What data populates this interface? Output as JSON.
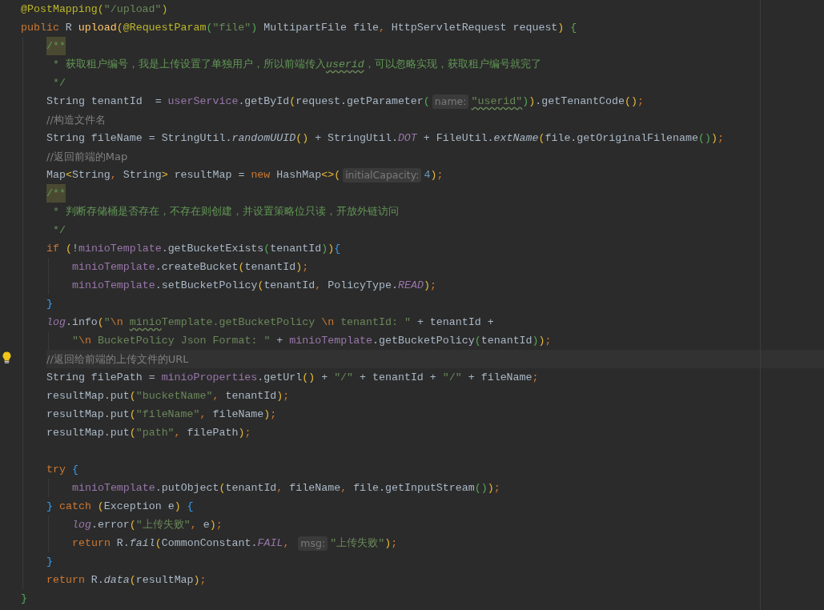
{
  "editor": {
    "lines": [
      {
        "tokens": [
          {
            "kind": "ann",
            "text": "@PostMapping("
          },
          {
            "kind": "str",
            "text": "\"/upload\""
          },
          {
            "kind": "ann",
            "text": ")"
          }
        ]
      },
      {
        "tokens": [
          {
            "kind": "kw",
            "text": "public "
          },
          {
            "kind": "p",
            "text": "R "
          },
          {
            "kind": "mth",
            "text": "upload"
          },
          {
            "kind": "b1",
            "text": "("
          },
          {
            "kind": "ann",
            "text": "@RequestParam"
          },
          {
            "kind": "b2",
            "text": "("
          },
          {
            "kind": "str",
            "text": "\"file\""
          },
          {
            "kind": "b2",
            "text": ")"
          },
          {
            "kind": "p",
            "text": " MultipartFile file"
          },
          {
            "kind": "punct",
            "text": ","
          },
          {
            "kind": "p",
            "text": " HttpServletRequest request"
          },
          {
            "kind": "b1",
            "text": ") "
          },
          {
            "kind": "b2",
            "text": "{"
          }
        ],
        "children": [
          {
            "tokens": [
              {
                "kind": "docstart",
                "text": "/**"
              }
            ]
          },
          {
            "tokens": [
              {
                "kind": "doc",
                "text": " * 获取租户编号，我是上传设置了单独用户，所以前端传入"
              },
              {
                "kind": "docref",
                "text": "userid"
              },
              {
                "kind": "doc",
                "text": "，可以忽略实现，获取租户编号就完了"
              }
            ]
          },
          {
            "tokens": [
              {
                "kind": "doc",
                "text": " */"
              }
            ]
          },
          {
            "tokens": [
              {
                "kind": "p",
                "text": "String tenantId  = "
              },
              {
                "kind": "fld",
                "text": "userService"
              },
              {
                "kind": "p",
                "text": ".getById"
              },
              {
                "kind": "b1",
                "text": "("
              },
              {
                "kind": "p",
                "text": "request.getParameter"
              },
              {
                "kind": "b2",
                "text": "("
              },
              {
                "kind": "hint",
                "text": "name:"
              },
              {
                "kind": "typo",
                "text": "\"userid\""
              },
              {
                "kind": "b2",
                "text": ")"
              },
              {
                "kind": "b1",
                "text": ")"
              },
              {
                "kind": "p",
                "text": ".getTenantCode"
              },
              {
                "kind": "b1",
                "text": "()"
              },
              {
                "kind": "punct",
                "text": ";"
              }
            ]
          },
          {
            "tokens": [
              {
                "kind": "cmt",
                "text": "//构造文件名"
              }
            ]
          },
          {
            "tokens": [
              {
                "kind": "p",
                "text": "String fileName = StringUtil."
              },
              {
                "kind": "sm",
                "text": "randomUUID"
              },
              {
                "kind": "b1",
                "text": "()"
              },
              {
                "kind": "p",
                "text": " + StringUtil."
              },
              {
                "kind": "sfld",
                "text": "DOT"
              },
              {
                "kind": "p",
                "text": " + FileUtil."
              },
              {
                "kind": "sm",
                "text": "extName"
              },
              {
                "kind": "b1",
                "text": "("
              },
              {
                "kind": "p",
                "text": "file.getOriginalFilename"
              },
              {
                "kind": "b2",
                "text": "()"
              },
              {
                "kind": "b1",
                "text": ")"
              },
              {
                "kind": "punct",
                "text": ";"
              }
            ]
          },
          {
            "tokens": [
              {
                "kind": "cmt",
                "text": "//返回前端的Map"
              }
            ]
          },
          {
            "tokens": [
              {
                "kind": "p",
                "text": "Map"
              },
              {
                "kind": "b1",
                "text": "<"
              },
              {
                "kind": "p",
                "text": "String"
              },
              {
                "kind": "punct",
                "text": ","
              },
              {
                "kind": "p",
                "text": " String"
              },
              {
                "kind": "b1",
                "text": ">"
              },
              {
                "kind": "p",
                "text": " resultMap = "
              },
              {
                "kind": "kw",
                "text": "new"
              },
              {
                "kind": "p",
                "text": " HashMap"
              },
              {
                "kind": "b1",
                "text": "<>("
              },
              {
                "kind": "hint",
                "text": "initialCapacity:"
              },
              {
                "kind": "num",
                "text": "4"
              },
              {
                "kind": "b1",
                "text": ")"
              },
              {
                "kind": "punct",
                "text": ";"
              }
            ]
          },
          {
            "tokens": [
              {
                "kind": "docstart",
                "text": "/**"
              }
            ]
          },
          {
            "tokens": [
              {
                "kind": "doc",
                "text": " * 判断存储桶是否存在，不存在则创建，并设置策略位只读，开放外链访问"
              }
            ]
          },
          {
            "tokens": [
              {
                "kind": "doc",
                "text": " */"
              }
            ]
          },
          {
            "tokens": [
              {
                "kind": "kw",
                "text": "if "
              },
              {
                "kind": "b1",
                "text": "("
              },
              {
                "kind": "p",
                "text": "!"
              },
              {
                "kind": "fld",
                "text": "minioTemplate"
              },
              {
                "kind": "p",
                "text": ".getBucketExists"
              },
              {
                "kind": "b2",
                "text": "("
              },
              {
                "kind": "p",
                "text": "tenantId"
              },
              {
                "kind": "b2",
                "text": ")"
              },
              {
                "kind": "b1",
                "text": ")"
              },
              {
                "kind": "b3",
                "text": "{"
              }
            ],
            "children": [
              {
                "tokens": [
                  {
                    "kind": "fld",
                    "text": "minioTemplate"
                  },
                  {
                    "kind": "p",
                    "text": ".createBucket"
                  },
                  {
                    "kind": "b1",
                    "text": "("
                  },
                  {
                    "kind": "p",
                    "text": "tenantId"
                  },
                  {
                    "kind": "b1",
                    "text": ")"
                  },
                  {
                    "kind": "punct",
                    "text": ";"
                  }
                ]
              },
              {
                "tokens": [
                  {
                    "kind": "fld",
                    "text": "minioTemplate"
                  },
                  {
                    "kind": "p",
                    "text": ".setBucketPolicy"
                  },
                  {
                    "kind": "b1",
                    "text": "("
                  },
                  {
                    "kind": "p",
                    "text": "tenantId"
                  },
                  {
                    "kind": "punct",
                    "text": ","
                  },
                  {
                    "kind": "p",
                    "text": " PolicyType."
                  },
                  {
                    "kind": "sfld",
                    "text": "READ"
                  },
                  {
                    "kind": "b1",
                    "text": ")"
                  },
                  {
                    "kind": "punct",
                    "text": ";"
                  }
                ]
              }
            ]
          },
          {
            "tokens": [
              {
                "kind": "b3",
                "text": "}"
              }
            ]
          },
          {
            "tokens": [
              {
                "kind": "sfld",
                "text": "log"
              },
              {
                "kind": "p",
                "text": ".info"
              },
              {
                "kind": "b1",
                "text": "("
              },
              {
                "kind": "str",
                "text": "\""
              },
              {
                "kind": "kw",
                "text": "\\n "
              },
              {
                "kind": "typo",
                "text": "minio"
              },
              {
                "kind": "str",
                "text": "Template.getBucketPolicy "
              },
              {
                "kind": "kw",
                "text": "\\n"
              },
              {
                "kind": "str",
                "text": " tenantId: \""
              },
              {
                "kind": "p",
                "text": " + tenantId +"
              }
            ],
            "children": [
              {
                "tokens": [
                  {
                    "kind": "str",
                    "text": "\""
                  },
                  {
                    "kind": "kw",
                    "text": "\\n"
                  },
                  {
                    "kind": "str",
                    "text": " BucketPolicy Json Format: \""
                  },
                  {
                    "kind": "p",
                    "text": " + "
                  },
                  {
                    "kind": "fld",
                    "text": "minioTemplate"
                  },
                  {
                    "kind": "p",
                    "text": ".getBucketPolicy"
                  },
                  {
                    "kind": "b2",
                    "text": "("
                  },
                  {
                    "kind": "p",
                    "text": "tenantId"
                  },
                  {
                    "kind": "b2",
                    "text": ")"
                  },
                  {
                    "kind": "b1",
                    "text": ")"
                  },
                  {
                    "kind": "punct",
                    "text": ";"
                  }
                ]
              }
            ]
          },
          {
            "current": true,
            "tokens": [
              {
                "kind": "cmt",
                "text": "//返回给前端的上传文件的URL"
              }
            ]
          },
          {
            "tokens": [
              {
                "kind": "p",
                "text": "String filePath = "
              },
              {
                "kind": "fld",
                "text": "minioProperties"
              },
              {
                "kind": "p",
                "text": ".getUrl"
              },
              {
                "kind": "b1",
                "text": "()"
              },
              {
                "kind": "p",
                "text": " + "
              },
              {
                "kind": "str",
                "text": "\"/\""
              },
              {
                "kind": "p",
                "text": " + tenantId + "
              },
              {
                "kind": "str",
                "text": "\"/\""
              },
              {
                "kind": "p",
                "text": " + fileName"
              },
              {
                "kind": "punct",
                "text": ";"
              }
            ]
          },
          {
            "tokens": [
              {
                "kind": "p",
                "text": "resultMap.put"
              },
              {
                "kind": "b1",
                "text": "("
              },
              {
                "kind": "str",
                "text": "\"bucketName\""
              },
              {
                "kind": "punct",
                "text": ","
              },
              {
                "kind": "p",
                "text": " tenantId"
              },
              {
                "kind": "b1",
                "text": ")"
              },
              {
                "kind": "punct",
                "text": ";"
              }
            ]
          },
          {
            "tokens": [
              {
                "kind": "p",
                "text": "resultMap.put"
              },
              {
                "kind": "b1",
                "text": "("
              },
              {
                "kind": "str",
                "text": "\"fileName\""
              },
              {
                "kind": "punct",
                "text": ","
              },
              {
                "kind": "p",
                "text": " fileName"
              },
              {
                "kind": "b1",
                "text": ")"
              },
              {
                "kind": "punct",
                "text": ";"
              }
            ]
          },
          {
            "gap_after": true,
            "tokens": [
              {
                "kind": "p",
                "text": "resultMap.put"
              },
              {
                "kind": "b1",
                "text": "("
              },
              {
                "kind": "str",
                "text": "\"path\""
              },
              {
                "kind": "punct",
                "text": ","
              },
              {
                "kind": "p",
                "text": " filePath"
              },
              {
                "kind": "b1",
                "text": ")"
              },
              {
                "kind": "punct",
                "text": ";"
              }
            ]
          },
          {
            "tokens": [
              {
                "kind": "kw",
                "text": "try "
              },
              {
                "kind": "b3",
                "text": "{"
              }
            ],
            "children": [
              {
                "tokens": [
                  {
                    "kind": "fld",
                    "text": "minioTemplate"
                  },
                  {
                    "kind": "p",
                    "text": ".putObject"
                  },
                  {
                    "kind": "b1",
                    "text": "("
                  },
                  {
                    "kind": "p",
                    "text": "tenantId"
                  },
                  {
                    "kind": "punct",
                    "text": ","
                  },
                  {
                    "kind": "p",
                    "text": " fileName"
                  },
                  {
                    "kind": "punct",
                    "text": ","
                  },
                  {
                    "kind": "p",
                    "text": " file.getInputStream"
                  },
                  {
                    "kind": "b2",
                    "text": "()"
                  },
                  {
                    "kind": "b1",
                    "text": ")"
                  },
                  {
                    "kind": "punct",
                    "text": ";"
                  }
                ]
              }
            ]
          },
          {
            "tokens": [
              {
                "kind": "b3",
                "text": "} "
              },
              {
                "kind": "kw",
                "text": "catch "
              },
              {
                "kind": "b1",
                "text": "("
              },
              {
                "kind": "p",
                "text": "Exception e"
              },
              {
                "kind": "b1",
                "text": ") "
              },
              {
                "kind": "b3",
                "text": "{"
              }
            ],
            "children": [
              {
                "tokens": [
                  {
                    "kind": "sfld",
                    "text": "log"
                  },
                  {
                    "kind": "p",
                    "text": ".error"
                  },
                  {
                    "kind": "b1",
                    "text": "("
                  },
                  {
                    "kind": "str",
                    "text": "\"上传失败\""
                  },
                  {
                    "kind": "punct",
                    "text": ","
                  },
                  {
                    "kind": "p",
                    "text": " e"
                  },
                  {
                    "kind": "b1",
                    "text": ")"
                  },
                  {
                    "kind": "punct",
                    "text": ";"
                  }
                ]
              },
              {
                "tokens": [
                  {
                    "kind": "kw",
                    "text": "return"
                  },
                  {
                    "kind": "p",
                    "text": " R."
                  },
                  {
                    "kind": "sm",
                    "text": "fail"
                  },
                  {
                    "kind": "b1",
                    "text": "("
                  },
                  {
                    "kind": "p",
                    "text": "CommonConstant."
                  },
                  {
                    "kind": "sfld",
                    "text": "FAIL"
                  },
                  {
                    "kind": "punct",
                    "text": ", "
                  },
                  {
                    "kind": "hint",
                    "text": "msg:"
                  },
                  {
                    "kind": "str",
                    "text": "\"上传失败\""
                  },
                  {
                    "kind": "b1",
                    "text": ")"
                  },
                  {
                    "kind": "punct",
                    "text": ";"
                  }
                ]
              }
            ]
          },
          {
            "tokens": [
              {
                "kind": "b3",
                "text": "}"
              }
            ]
          },
          {
            "tokens": [
              {
                "kind": "kw",
                "text": "return"
              },
              {
                "kind": "p",
                "text": " R."
              },
              {
                "kind": "sm",
                "text": "data"
              },
              {
                "kind": "b1",
                "text": "("
              },
              {
                "kind": "p",
                "text": "resultMap"
              },
              {
                "kind": "b1",
                "text": ")"
              },
              {
                "kind": "punct",
                "text": ";"
              }
            ]
          }
        ]
      },
      {
        "tokens": [
          {
            "kind": "b2",
            "text": "}"
          }
        ]
      }
    ]
  }
}
